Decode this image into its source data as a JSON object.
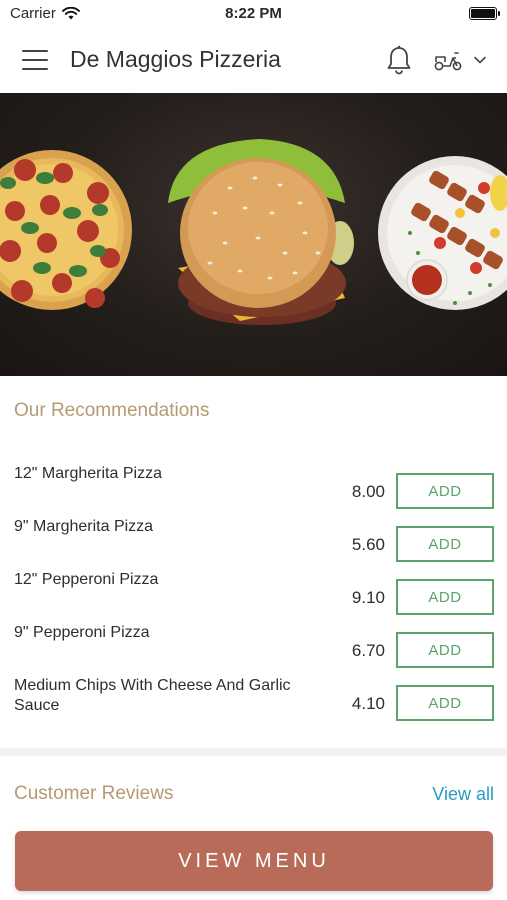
{
  "status_bar": {
    "carrier": "Carrier",
    "time": "8:22 PM"
  },
  "header": {
    "title": "De Maggios Pizzeria",
    "icons": [
      "menu-icon",
      "bell-icon",
      "scooter-icon",
      "chevron-down-icon"
    ]
  },
  "hero": {
    "foods": [
      "pizza",
      "burger",
      "kebab-skewers"
    ]
  },
  "recommendations": {
    "title": "Our Recommendations",
    "add_label": "ADD",
    "items": [
      {
        "name": "12\" Margherita Pizza",
        "price": "8.00"
      },
      {
        "name": "9\" Margherita Pizza",
        "price": "5.60"
      },
      {
        "name": "12\" Pepperoni Pizza",
        "price": "9.10"
      },
      {
        "name": "9\" Pepperoni Pizza",
        "price": "6.70"
      },
      {
        "name": "Medium Chips With Cheese And Garlic Sauce",
        "price": "4.10"
      }
    ]
  },
  "reviews": {
    "title": "Customer Reviews",
    "view_all": "View all"
  },
  "cta": {
    "label": "VIEW MENU"
  },
  "colors": {
    "accent_gold": "#b59a73",
    "add_green": "#5aa46a",
    "link_blue": "#2a9bbd",
    "cta_terracotta": "#b86b58"
  }
}
